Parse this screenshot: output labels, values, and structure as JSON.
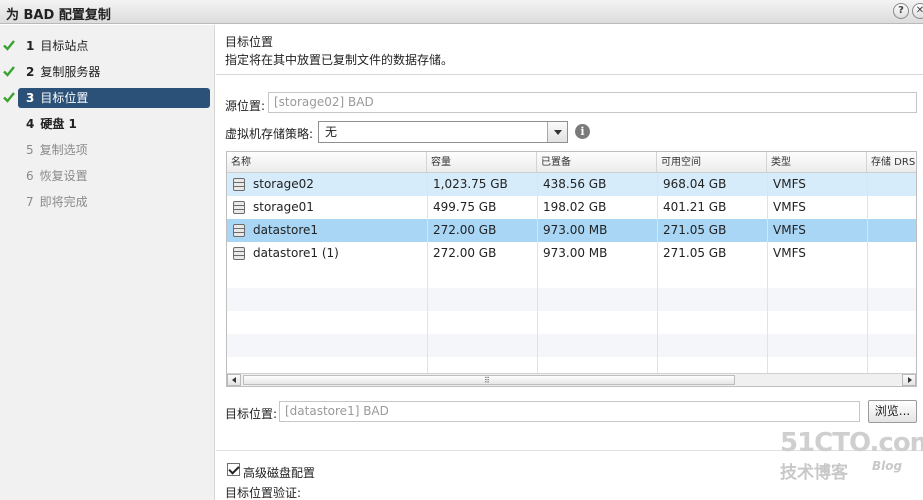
{
  "window": {
    "title": "为 BAD 配置复制",
    "help_glyph": "?",
    "close_glyph": "✕"
  },
  "sidebar": {
    "steps": [
      {
        "num": "1",
        "label": "目标站点",
        "state": "done"
      },
      {
        "num": "2",
        "label": "复制服务器",
        "state": "done"
      },
      {
        "num": "3",
        "label": "目标位置",
        "state": "active"
      },
      {
        "num": "4",
        "label": "硬盘 1",
        "state": "next"
      },
      {
        "num": "5",
        "label": "复制选项",
        "state": "disabled"
      },
      {
        "num": "6",
        "label": "恢复设置",
        "state": "disabled"
      },
      {
        "num": "7",
        "label": "即将完成",
        "state": "disabled"
      }
    ]
  },
  "main": {
    "section_title": "目标位置",
    "section_desc": "指定将在其中放置已复制文件的数据存储。",
    "source_label": "源位置:",
    "source_value": "[storage02] BAD",
    "policy_label": "虚拟机存储策略:",
    "policy_value": "无",
    "info_glyph": "i",
    "table": {
      "columns": [
        "名称",
        "容量",
        "已置备",
        "可用空间",
        "类型",
        "存储 DRS"
      ],
      "rows": [
        {
          "name": "storage02",
          "capacity": "1,023.75 GB",
          "provisioned": "438.56 GB",
          "free": "968.04 GB",
          "type": "VMFS",
          "drs": ""
        },
        {
          "name": "storage01",
          "capacity": "499.75 GB",
          "provisioned": "198.02 GB",
          "free": "401.21 GB",
          "type": "VMFS",
          "drs": ""
        },
        {
          "name": "datastore1",
          "capacity": "272.00 GB",
          "provisioned": "973.00 MB",
          "free": "271.05 GB",
          "type": "VMFS",
          "drs": ""
        },
        {
          "name": "datastore1 (1)",
          "capacity": "272.00 GB",
          "provisioned": "973.00 MB",
          "free": "271.05 GB",
          "type": "VMFS",
          "drs": ""
        }
      ],
      "scroll_grip": "⠿"
    },
    "target_label": "目标位置:",
    "target_value": "[datastore1] BAD",
    "browse_label": "浏览...",
    "advanced_label": "高级磁盘配置",
    "advanced_checked": true,
    "validation_label": "目标位置验证:"
  },
  "watermark": {
    "big": "51CTO.com",
    "small": "技术博客",
    "blog": "Blog"
  },
  "colors": {
    "active_step": "#2c5179",
    "check": "#3aa32f",
    "row_highlight": "#d6ecfa",
    "row_selected": "#a9d6f5"
  }
}
